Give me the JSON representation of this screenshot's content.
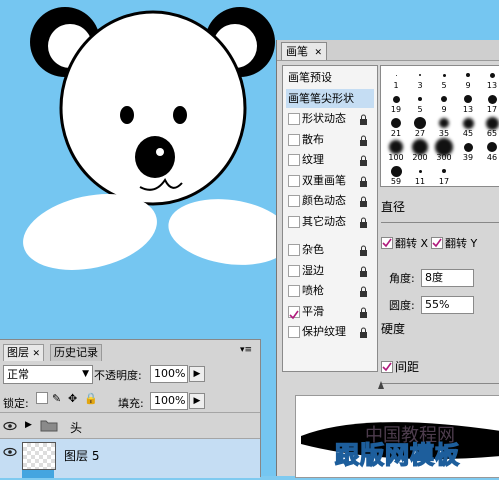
{
  "brush_panel": {
    "tab_label": "画笔",
    "items": [
      {
        "label": "画笔预设",
        "type": "head"
      },
      {
        "label": "画笔笔尖形状",
        "type": "head",
        "selected": true
      },
      {
        "label": "形状动态",
        "checked": false
      },
      {
        "label": "散布",
        "checked": false
      },
      {
        "label": "纹理",
        "checked": false
      },
      {
        "label": "双重画笔",
        "checked": false
      },
      {
        "label": "颜色动态",
        "checked": false
      },
      {
        "label": "其它动态",
        "checked": false
      },
      {
        "label": "杂色",
        "checked": false
      },
      {
        "label": "湿边",
        "checked": false
      },
      {
        "label": "喷枪",
        "checked": false
      },
      {
        "label": "平滑",
        "checked": true
      },
      {
        "label": "保护纹理",
        "checked": false
      }
    ],
    "tips": [
      "1",
      "3",
      "5",
      "9",
      "13",
      "19",
      "5",
      "9",
      "13",
      "17",
      "21",
      "27",
      "35",
      "45",
      "65",
      "100",
      "200",
      "300",
      "39",
      "46",
      "59",
      "11",
      "17"
    ],
    "diameter_label": "直径",
    "flip_x_label": "翻转 X",
    "flip_y_label": "翻转 Y",
    "angle_label": "角度:",
    "angle_value": "8度",
    "roundness_label": "圆度:",
    "roundness_value": "55%",
    "hardness_label": "硬度",
    "spacing_label": "间距"
  },
  "layers_panel": {
    "tab_layers": "图层",
    "tab_history": "历史记录",
    "blend_mode": "正常",
    "opacity_label": "不透明度:",
    "opacity_value": "100%",
    "lock_label": "锁定:",
    "fill_label": "填充:",
    "fill_value": "100%",
    "layers": [
      {
        "name": "头",
        "kind": "group"
      },
      {
        "name": "图层 5",
        "kind": "layer",
        "selected": true
      }
    ]
  },
  "watermark": "跟版网模板",
  "watermark_faint": "中国教程网",
  "colors": {
    "canvas": "#75c6f1",
    "panel": "#d6d6d6",
    "selection": "#c5ddf3"
  }
}
